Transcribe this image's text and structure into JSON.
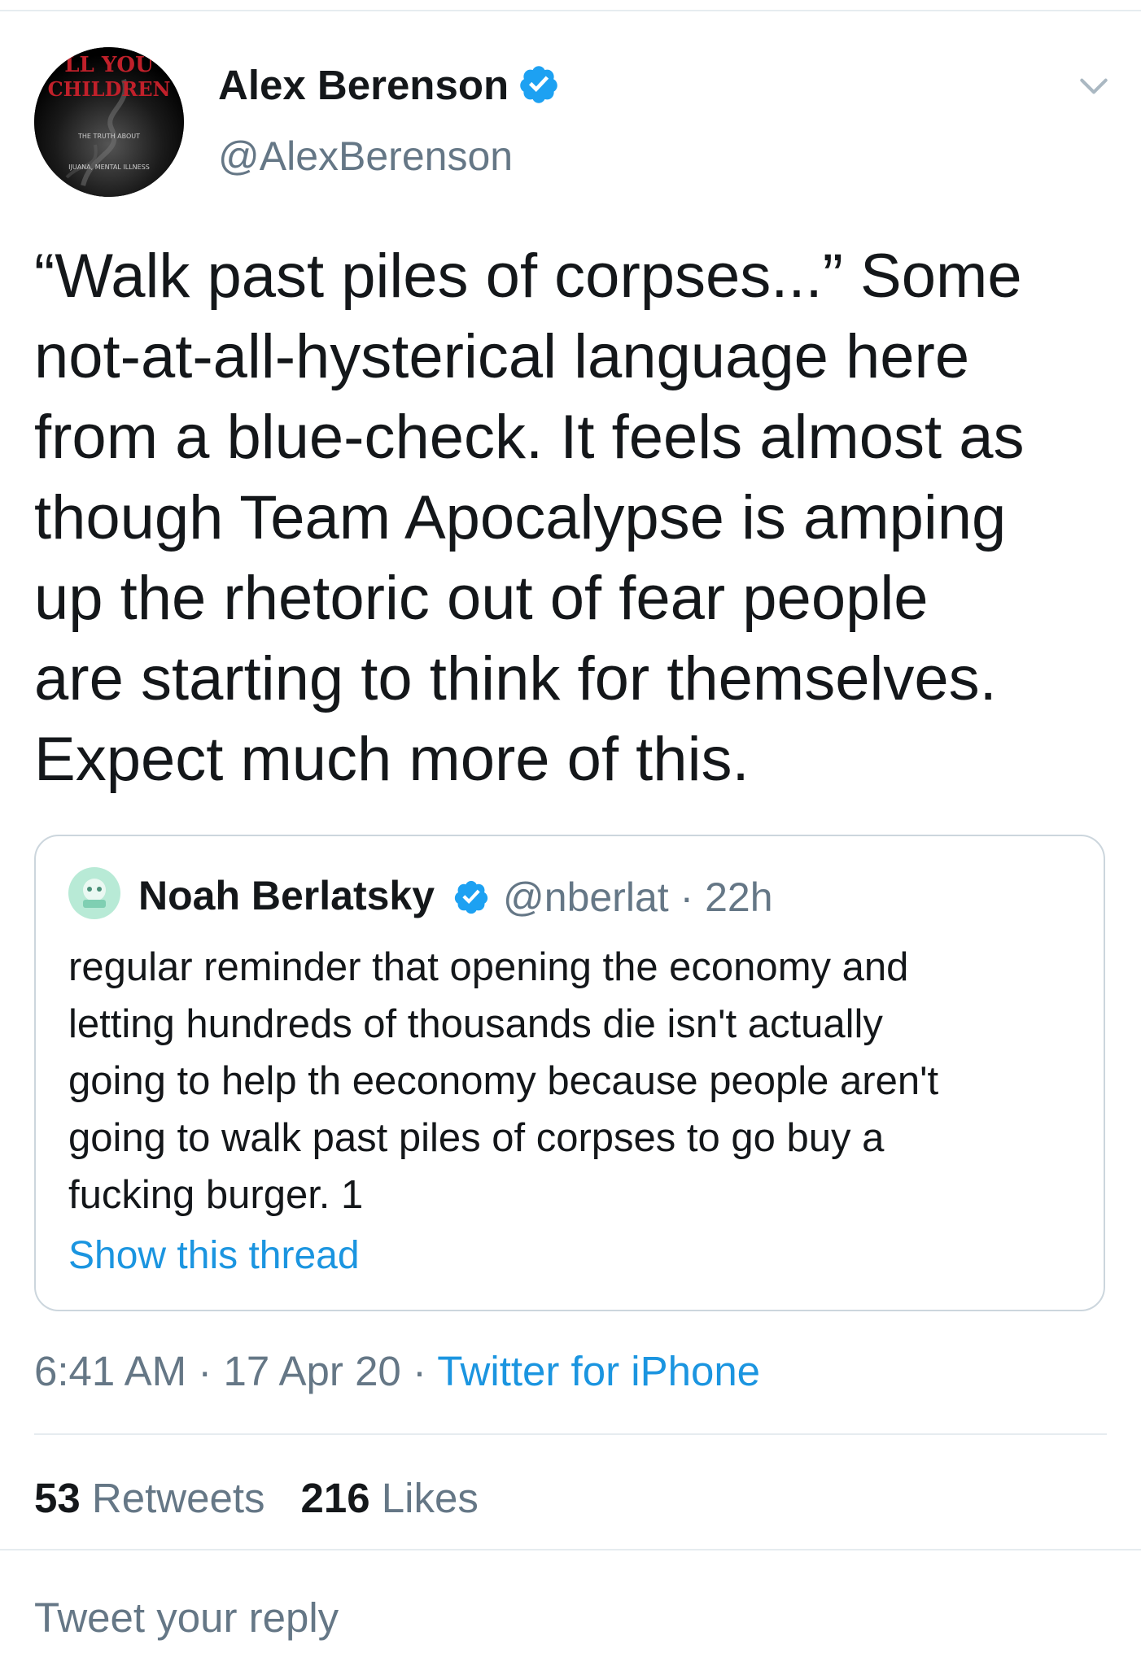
{
  "author": {
    "name": "Alex Berenson",
    "handle": "@AlexBerenson",
    "avatar_text": [
      "LL YOU",
      "CHILDREN",
      "THE TRUTH ABOUT",
      "IJUANA, MENTAL ILLNESS"
    ]
  },
  "tweet": {
    "text_lines": [
      "“Walk past piles of corpses...” Some",
      "not-at-all-hysterical language here",
      "from a blue-check. It feels almost as",
      "though Team Apocalypse is amping",
      "up the rhetoric out of fear people",
      "are starting to think for themselves.",
      "Expect much more of this."
    ]
  },
  "quoted": {
    "name": "Noah Berlatsky",
    "handle": "@nberlat",
    "separator": "·",
    "time": "22h",
    "text_lines": [
      "regular reminder that opening the economy and",
      "letting hundreds of thousands die isn't actually",
      "going to help th eeconomy because people aren't",
      "going to walk past piles of corpses to go buy a",
      "fucking burger. 1"
    ],
    "show_thread": "Show this thread"
  },
  "meta": {
    "time": "6:41 AM",
    "sep1": "·",
    "date": "17 Apr 20",
    "sep2": "·",
    "source": "Twitter for iPhone"
  },
  "stats": {
    "retweets_count": "53",
    "retweets_label": "Retweets",
    "likes_count": "216",
    "likes_label": "Likes"
  },
  "reply": {
    "placeholder": "Tweet your reply"
  },
  "colors": {
    "link": "#1b95e0",
    "secondary_text": "#657786",
    "border": "#e6ecf0",
    "verified": "#1da1f2"
  },
  "icons": {
    "verified": "verified-badge-icon",
    "chevron": "chevron-down-icon"
  }
}
